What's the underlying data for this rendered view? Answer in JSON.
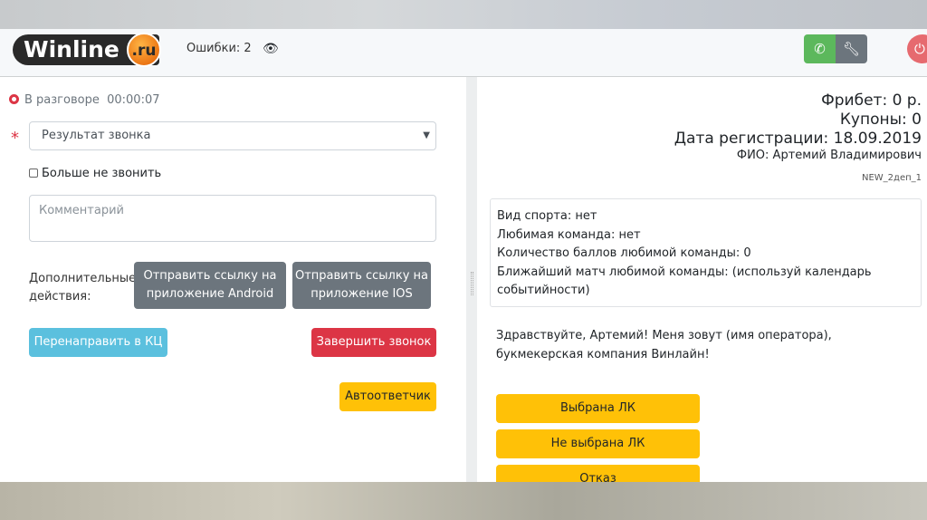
{
  "header": {
    "logo_text": "Winline",
    "logo_suffix": ".ru",
    "errors_label": "Ошибки: 2",
    "icons": [
      "eye-icon",
      "phone-icon",
      "wrench-icon",
      "power-icon"
    ]
  },
  "call": {
    "status": "В разговоре",
    "timer": "00:00:07",
    "result_select": {
      "value": "Результат звонка"
    },
    "dont_call_label": "Больше не звонить",
    "comment_placeholder": "Комментарий",
    "extra_actions_label": "Дополнительные действия:",
    "android_button": "Отправить ссылку на приложение Android",
    "ios_button": "Отправить ссылку на приложение IOS",
    "redirect_button": "Перенаправить в КЦ",
    "end_call_button": "Завершить звонок",
    "answering_machine_button": "Автоответчик"
  },
  "client": {
    "freebet": "Фрибет: 0 р.",
    "coupons": "Купоны: 0",
    "reg_date": "Дата регистрации: 18.09.2019",
    "name": "ФИО: Артемий Владимирович",
    "segment": "NEW_2деп_1",
    "details": [
      "Вид спорта: нет",
      "Любимая команда: нет",
      "Количество баллов любимой команды: 0",
      "Ближайший матч любимой команды: (используй календарь событийности)"
    ],
    "greeting": "Здравствуйте, Артемий! Меня зовут (имя оператора), букмекерская компания Винлайн!",
    "options": [
      "Выбрана ЛК",
      "Не выбрана ЛК",
      "Отказ"
    ]
  },
  "colors": {
    "green": "#5cb85c",
    "gray": "#6c757d",
    "red": "#dc3545",
    "cyan": "#5bc0de",
    "yellow": "#ffc107"
  }
}
